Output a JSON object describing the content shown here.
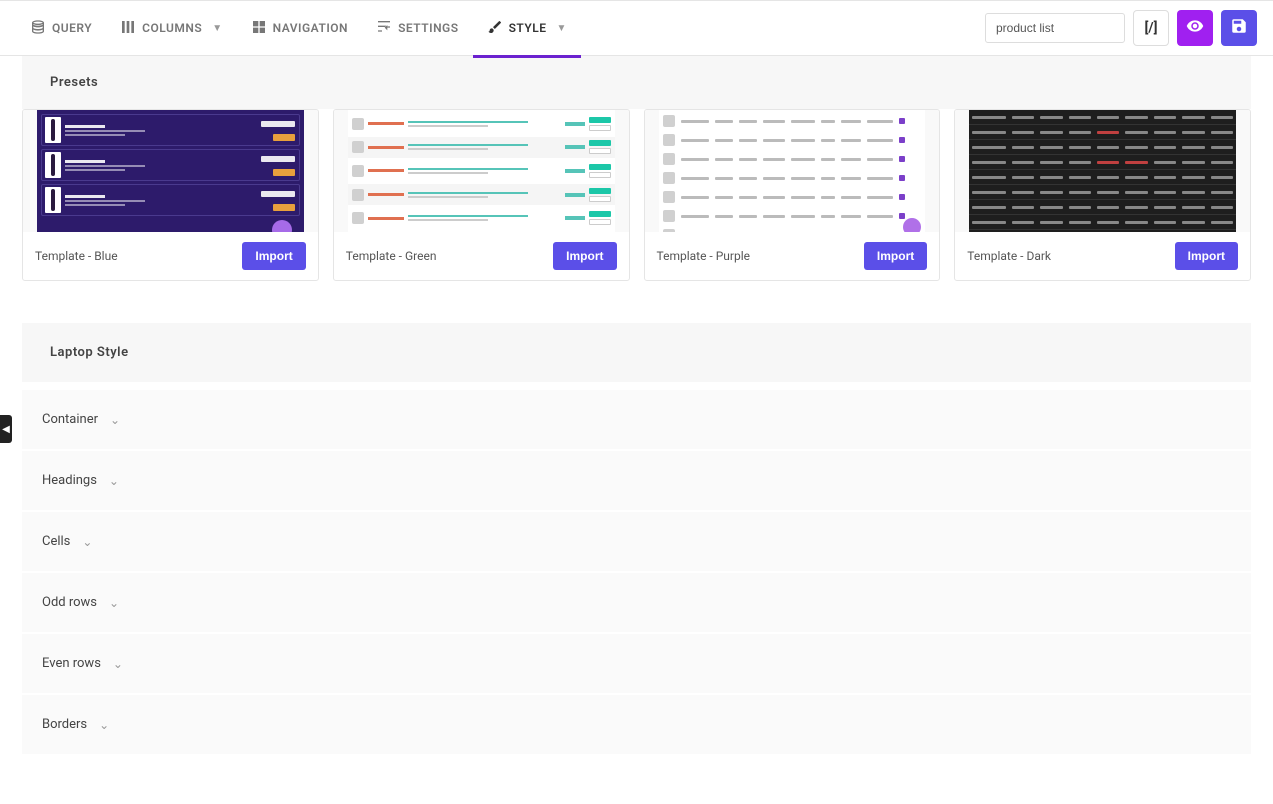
{
  "topbar": {
    "tabs": [
      {
        "label": "QUERY"
      },
      {
        "label": "COLUMNS",
        "caret": true
      },
      {
        "label": "NAVIGATION"
      },
      {
        "label": "SETTINGS"
      },
      {
        "label": "STYLE",
        "caret": true,
        "active": true
      }
    ],
    "search_value": "product list",
    "shortcode_label": "[/]"
  },
  "presets": {
    "header": "Presets",
    "items": [
      {
        "name": "Template - Blue",
        "import": "Import"
      },
      {
        "name": "Template - Green",
        "import": "Import"
      },
      {
        "name": "Template - Purple",
        "import": "Import"
      },
      {
        "name": "Template - Dark",
        "import": "Import"
      }
    ]
  },
  "laptop_style": {
    "header": "Laptop Style",
    "rows": [
      "Container",
      "Headings",
      "Cells",
      "Odd rows",
      "Even rows",
      "Borders"
    ]
  }
}
